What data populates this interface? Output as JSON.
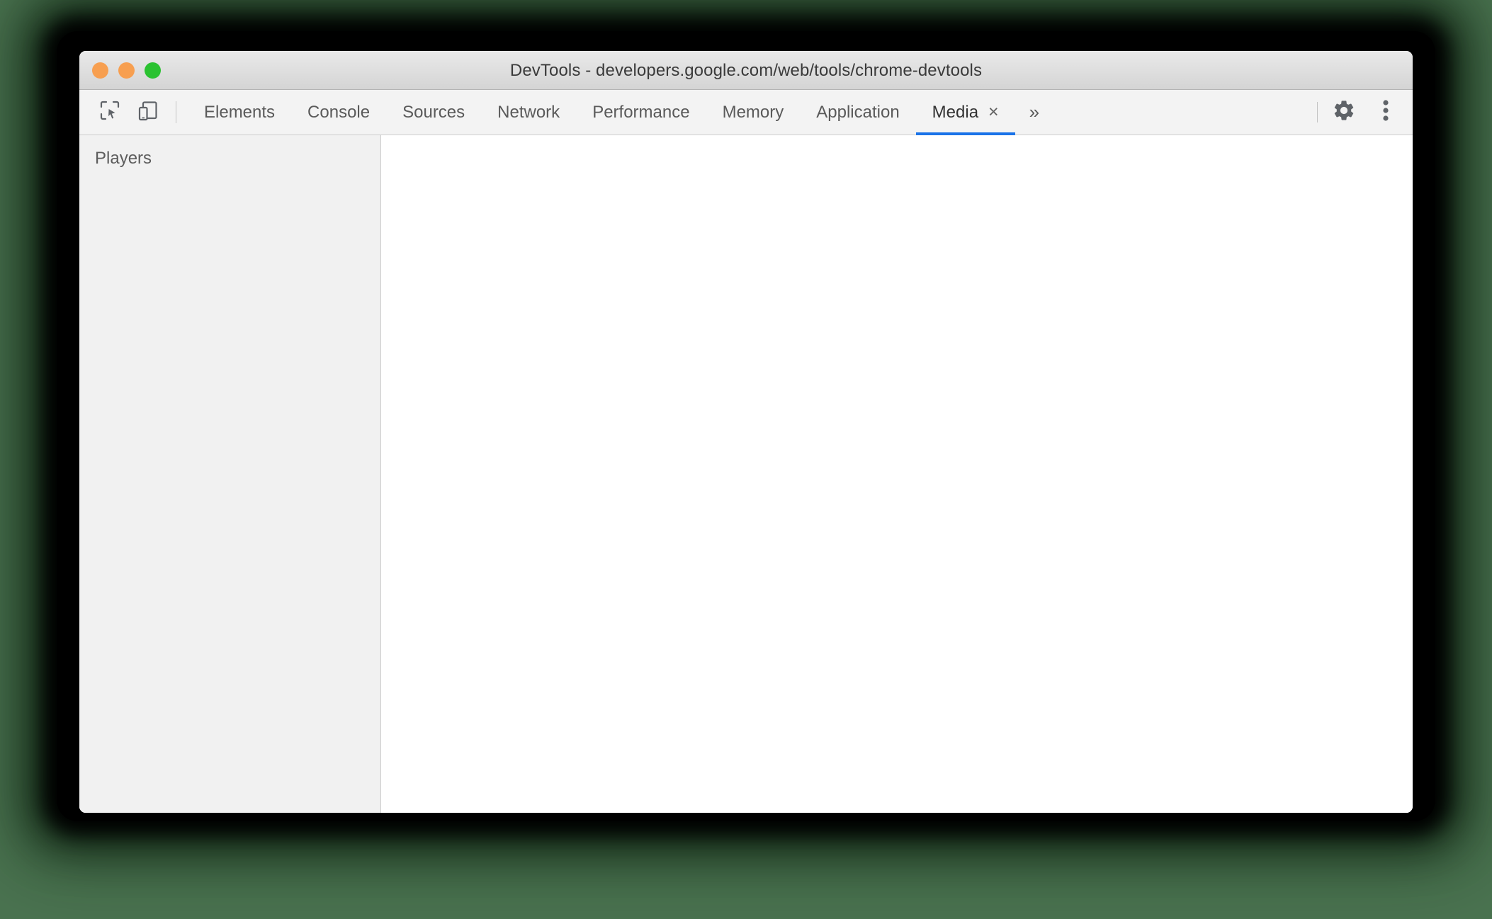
{
  "window": {
    "title": "DevTools - developers.google.com/web/tools/chrome-devtools",
    "traffic_lights": [
      {
        "name": "close",
        "color": "#f79f50"
      },
      {
        "name": "minimize",
        "color": "#f79f50"
      },
      {
        "name": "maximize",
        "color": "#2bc231"
      }
    ]
  },
  "toolbar": {
    "inspect_icon": "inspect-element-icon",
    "device_toolbar_icon": "device-toggle-icon",
    "more_tabs_label": "»",
    "settings_icon": "gear-icon",
    "more_options_icon": "three-dot-menu-icon",
    "tabs": [
      {
        "label": "Elements",
        "active": false,
        "closable": false
      },
      {
        "label": "Console",
        "active": false,
        "closable": false
      },
      {
        "label": "Sources",
        "active": false,
        "closable": false
      },
      {
        "label": "Network",
        "active": false,
        "closable": false
      },
      {
        "label": "Performance",
        "active": false,
        "closable": false
      },
      {
        "label": "Memory",
        "active": false,
        "closable": false
      },
      {
        "label": "Application",
        "active": false,
        "closable": false
      },
      {
        "label": "Media",
        "active": true,
        "closable": true,
        "close_label": "×"
      }
    ],
    "active_tab": "Media",
    "accent_color": "#1a73e8"
  },
  "media_panel": {
    "sidebar": {
      "header": "Players",
      "items": []
    },
    "main": {
      "content": ""
    }
  },
  "colors": {
    "desktop_background": "#4a7350",
    "titlebar_background": "#dedede",
    "toolbar_background": "#f3f3f3",
    "sidebar_background": "#f1f1f1",
    "main_background": "#ffffff",
    "accent": "#1a73e8"
  }
}
